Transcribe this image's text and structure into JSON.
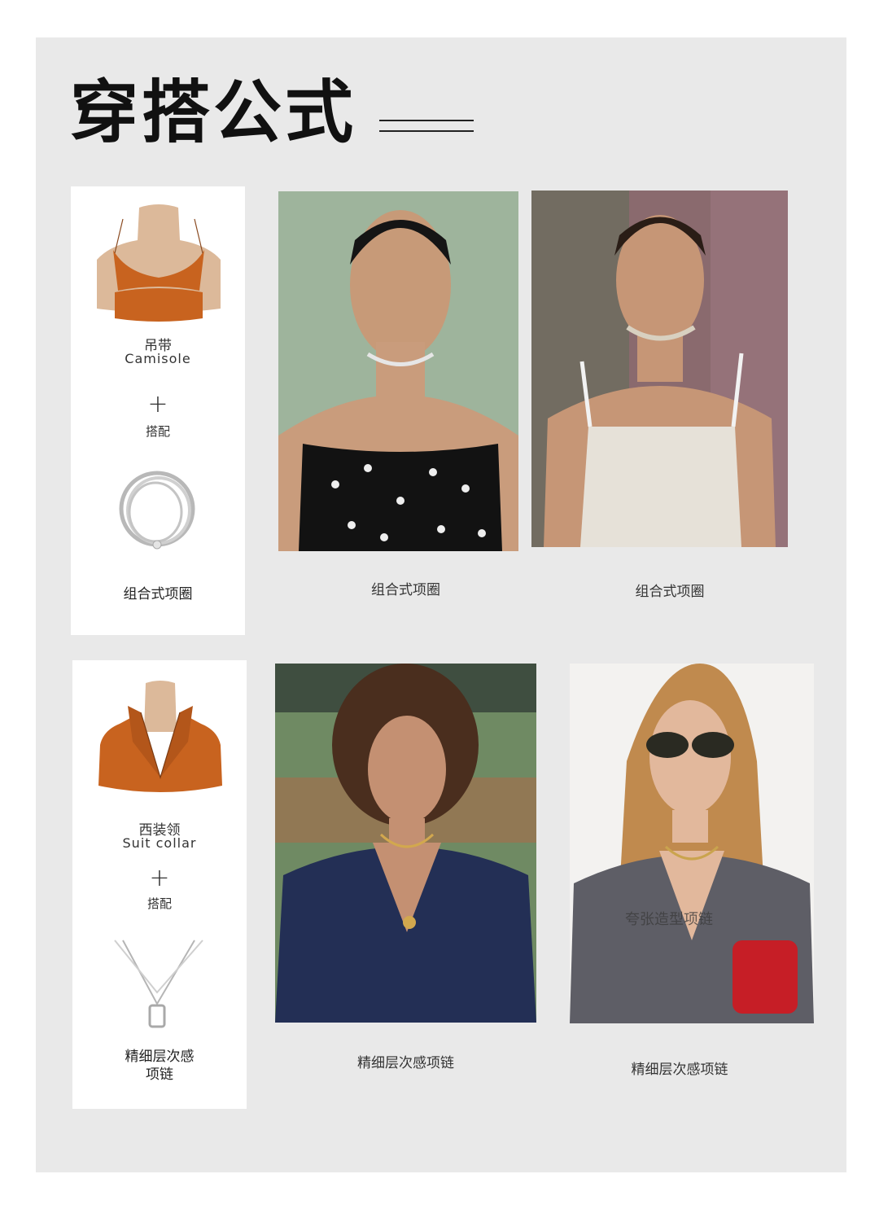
{
  "title": "穿搭公式",
  "rows": [
    {
      "garment_cn": "吊带",
      "garment_en": "Camisole",
      "plus": "+",
      "pair": "搭配",
      "accessory": "组合式项圈",
      "captions": [
        "组合式项圈",
        "组合式项圈"
      ]
    },
    {
      "garment_cn": "西装领",
      "garment_en": "Suit collar",
      "plus": "+",
      "pair": "搭配",
      "accessory_line1": "精细层次感",
      "accessory_line2": "项链",
      "captions": [
        "精细层次感项链",
        "精细层次感项链"
      ]
    }
  ],
  "icons": [
    "camisole-sketch",
    "choker-illustration",
    "suit-collar-sketch",
    "layered-necklace-illustration"
  ],
  "colors": {
    "panel": "#e9e9e9",
    "garment": "#c8631f",
    "skin": "#dcb99a"
  },
  "watermark": "夸张造型项链"
}
